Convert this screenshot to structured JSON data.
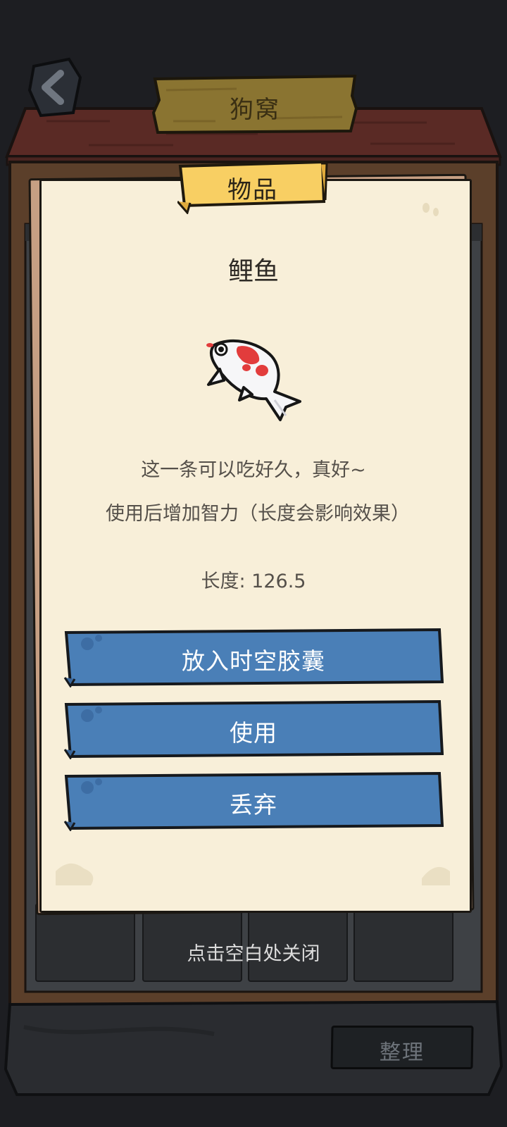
{
  "header": {
    "title": "狗窝",
    "back_icon": "chevron-left-icon"
  },
  "popup": {
    "tab_label": "物品",
    "item_name": "鲤鱼",
    "item_icon": "koi-fish-icon",
    "description": "这一条可以吃好久，真好~",
    "effect": "使用后增加智力（长度会影响效果）",
    "stat": "长度: 126.5",
    "buttons": [
      {
        "label": "放入时空胶囊"
      },
      {
        "label": "使用"
      },
      {
        "label": "丢弃"
      }
    ]
  },
  "close_hint": "点击空白处关闭",
  "footer": {
    "sort_label": "整理"
  },
  "colors": {
    "paper": "#f8efd9",
    "button_blue": "#4a7fb7",
    "ribbon_yellow": "#f8cf63",
    "sign_wood": "#8b7530",
    "roof": "#5b2a25",
    "cabinet_wood": "#5b3f2a"
  }
}
